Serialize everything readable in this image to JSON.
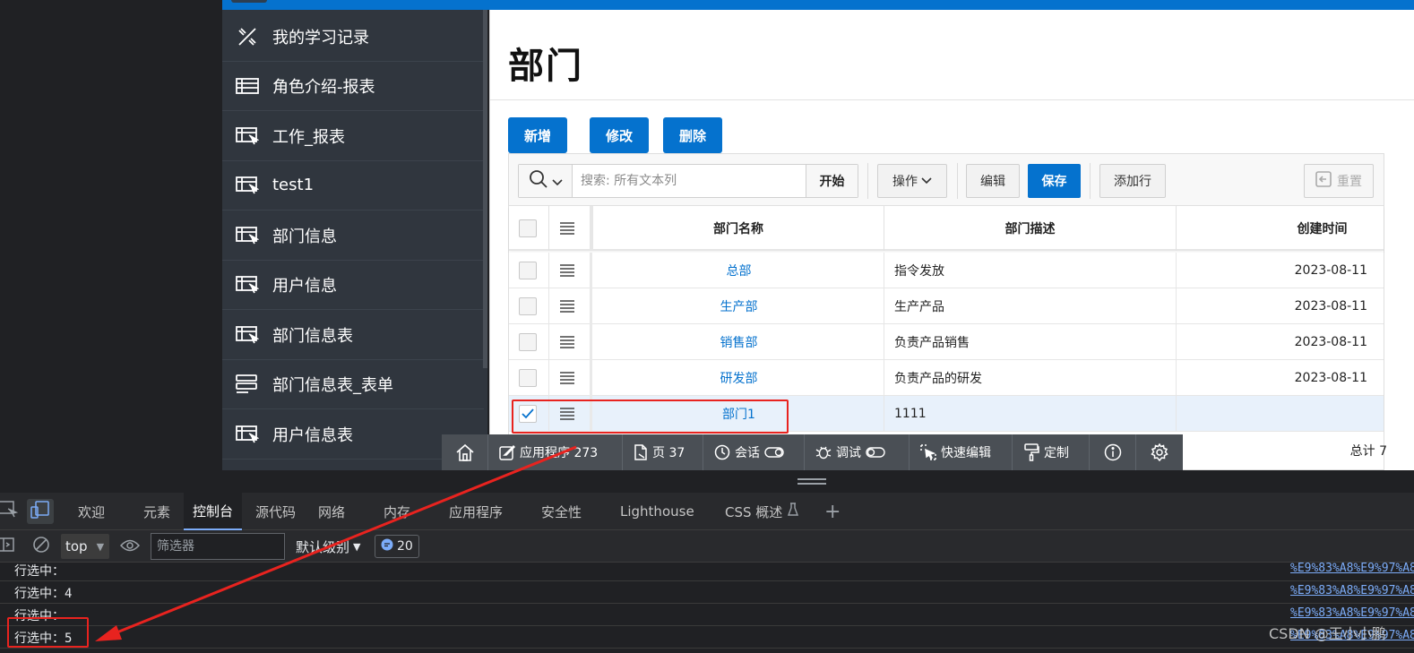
{
  "sidebar": {
    "items": [
      {
        "label": "我的学习记录",
        "icon": "tools-icon"
      },
      {
        "label": "角色介绍-报表",
        "icon": "table-icon"
      },
      {
        "label": "工作_报表",
        "icon": "report-icon"
      },
      {
        "label": "test1",
        "icon": "report-icon"
      },
      {
        "label": "部门信息",
        "icon": "report-icon"
      },
      {
        "label": "用户信息",
        "icon": "report-icon"
      },
      {
        "label": "部门信息表",
        "icon": "report-icon"
      },
      {
        "label": "部门信息表_表单",
        "icon": "form-icon"
      },
      {
        "label": "用户信息表",
        "icon": "report-icon"
      }
    ]
  },
  "page": {
    "title": "部门",
    "buttons": {
      "add": "新增",
      "edit": "修改",
      "delete": "删除"
    }
  },
  "toolbar": {
    "search_placeholder": "搜索: 所有文本列",
    "go": "开始",
    "actions": "操作",
    "edit": "编辑",
    "save": "保存",
    "add_row": "添加行",
    "reset": "重置"
  },
  "grid": {
    "columns": [
      "部门名称",
      "部门描述",
      "创建时间"
    ],
    "rows": [
      {
        "name": "总部",
        "desc": "指令发放",
        "date": "2023-08-11",
        "checked": false
      },
      {
        "name": "生产部",
        "desc": "生产产品",
        "date": "2023-08-11",
        "checked": false
      },
      {
        "name": "销售部",
        "desc": "负责产品销售",
        "date": "2023-08-11",
        "checked": false
      },
      {
        "name": "研发部",
        "desc": "负责产品的研发",
        "date": "2023-08-11",
        "checked": false
      },
      {
        "name": "部门1",
        "desc": "1111",
        "date": "",
        "checked": true
      }
    ],
    "total": "总计 7"
  },
  "devbar": {
    "app": "应用程序 273",
    "page": "页 37",
    "session": "会话",
    "debug": "调试",
    "quick_edit": "快速编辑",
    "customize": "定制"
  },
  "devtools": {
    "tabs": [
      "欢迎",
      "元素",
      "控制台",
      "源代码",
      "网络",
      "内存",
      "应用程序",
      "安全性",
      "Lighthouse",
      "CSS 概述"
    ],
    "active_tab": "控制台",
    "context": "top",
    "filter_placeholder": "筛选器",
    "level": "默认级别",
    "issues_count": "20"
  },
  "console": {
    "lines": [
      {
        "msg": "行选中：",
        "src": "%E9%83%A8%E9%97%A8"
      },
      {
        "msg": "行选中：4",
        "src": "%E9%83%A8%E9%97%A8"
      },
      {
        "msg": "行选中：",
        "src": "%E9%83%A8%E9%97%A8"
      },
      {
        "msg": "行选中：5",
        "src": "%E9%83%A8%E9%97%A8"
      }
    ]
  },
  "watermark": "CSDN @王小小鹏",
  "colors": {
    "accent": "#0572ce",
    "annotation": "#e8231f",
    "sidebar": "#30363e"
  }
}
